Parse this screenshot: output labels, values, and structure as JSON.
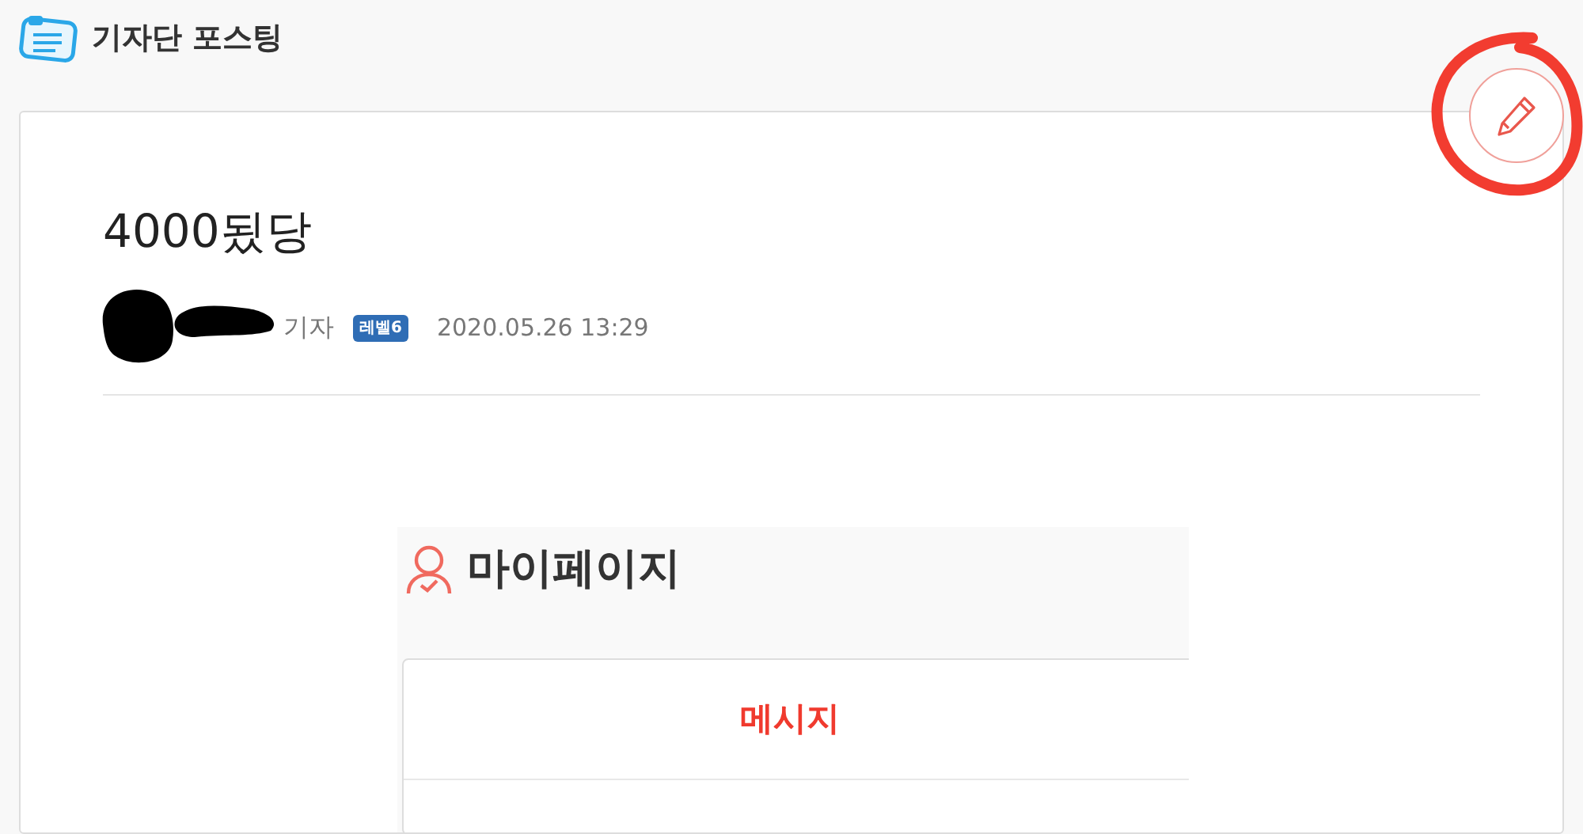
{
  "header": {
    "title": "기자단 포스팅"
  },
  "post": {
    "title": "4000됬당",
    "author_suffix": "기자",
    "level_badge": "레벨6",
    "date": "2020.05.26 13:29"
  },
  "embedded_screenshot": {
    "title": "마이페이지",
    "tab": "메시지"
  }
}
